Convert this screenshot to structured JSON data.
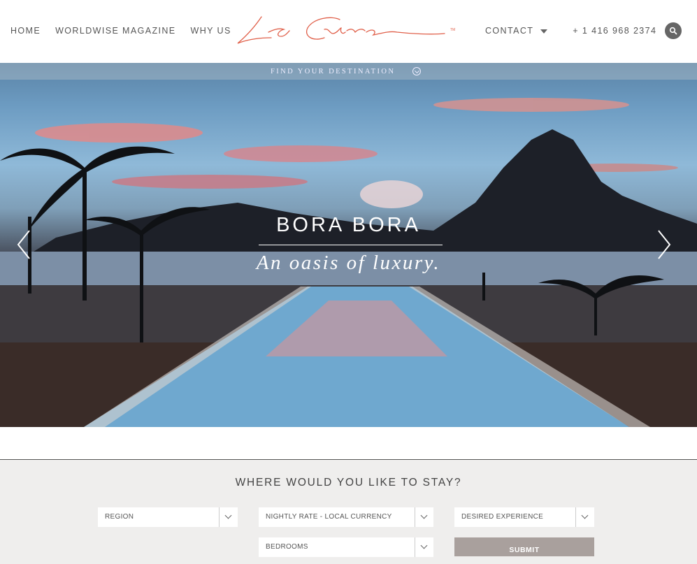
{
  "nav": {
    "home": "HOME",
    "magazine": "WORLDWISE MAGAZINE",
    "why_us": "WHY US",
    "contact": "CONTACT",
    "phone": "+ 1 416 968 2374"
  },
  "logo": {
    "text": "La Cure",
    "color": "#e0604a"
  },
  "hero": {
    "find_bar": "FIND YOUR DESTINATION",
    "title": "BORA BORA",
    "subtitle": "An oasis of luxury."
  },
  "search": {
    "heading": "WHERE WOULD YOU LIKE TO STAY?",
    "region": "REGION",
    "nightly_rate": "NIGHTLY RATE - LOCAL CURRENCY",
    "experience": "DESIRED EXPERIENCE",
    "bedrooms": "BEDROOMS",
    "submit": "SUBMIT"
  }
}
